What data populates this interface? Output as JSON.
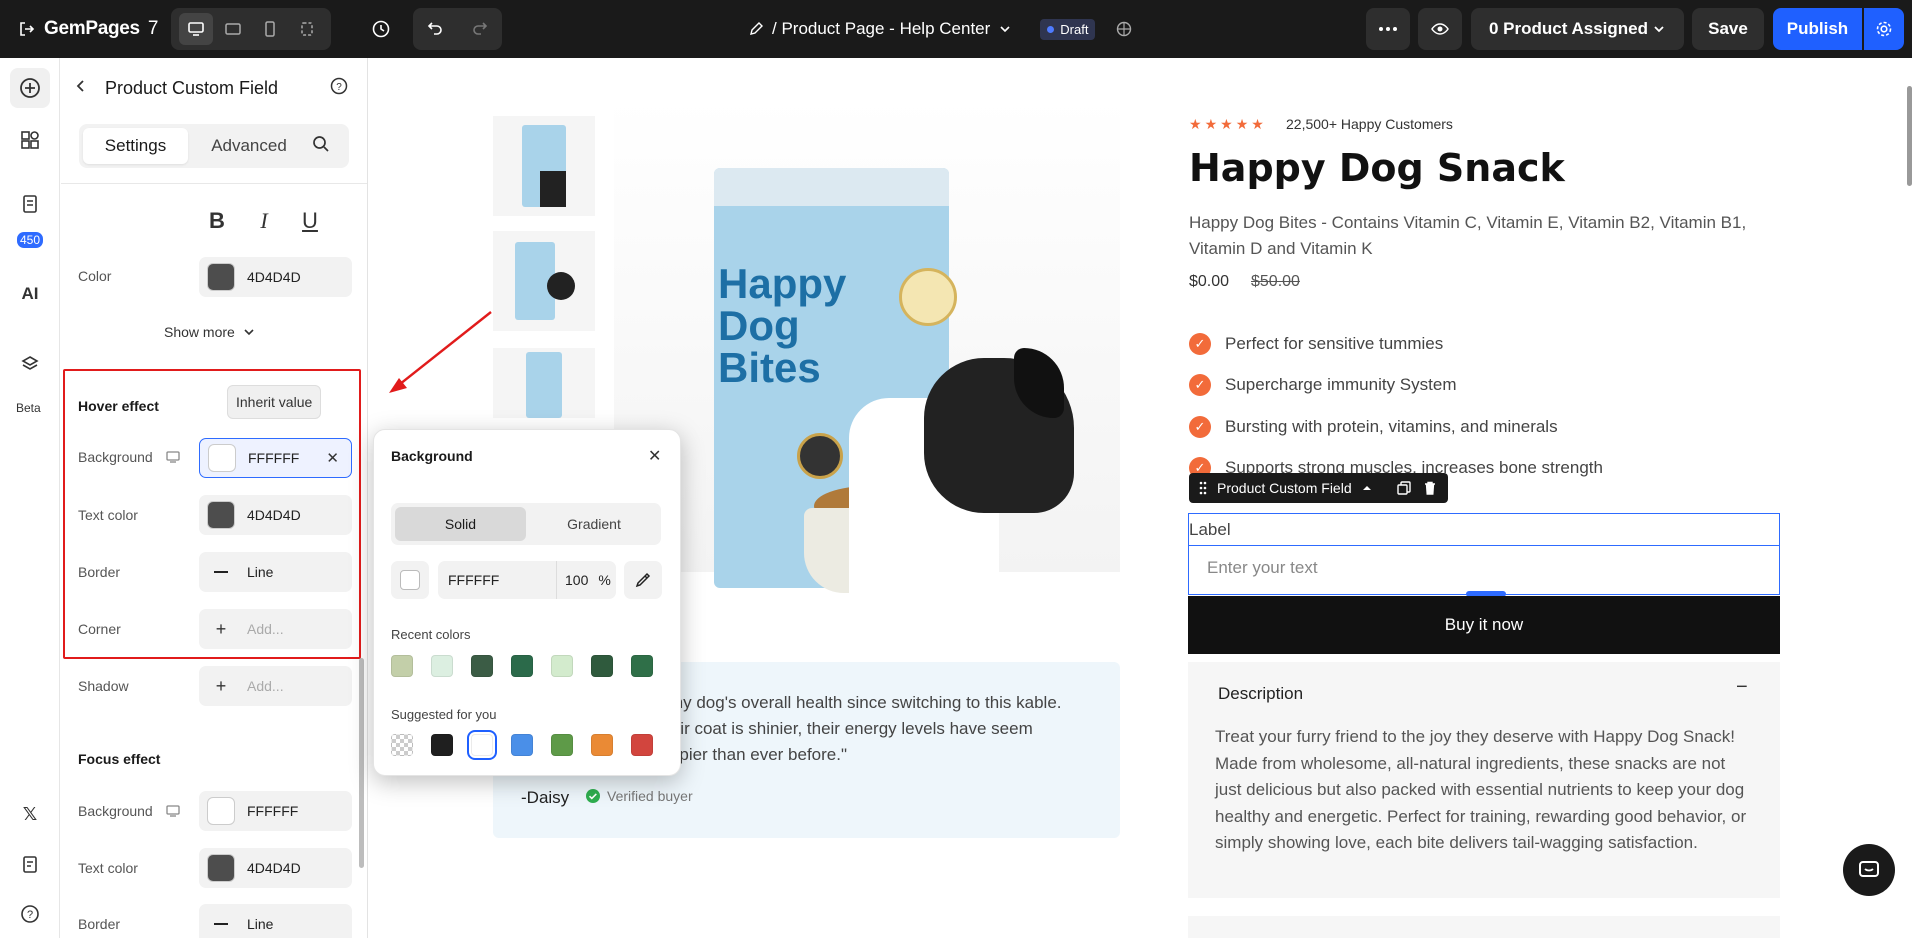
{
  "topbar": {
    "logo_text": "GemPages",
    "logo_version": "7",
    "page_title": "/ Product Page - Help Center",
    "status_badge": "Draft",
    "assigned": "0 Product Assigned",
    "save_label": "Save",
    "publish_label": "Publish"
  },
  "rail": {
    "badge_count": "450",
    "beta_label": "Beta"
  },
  "panel": {
    "title": "Product Custom Field",
    "tabs": {
      "settings": "Settings",
      "advanced": "Advanced"
    },
    "color_label": "Color",
    "color_value": "4D4D4D",
    "show_more": "Show more",
    "hover": {
      "title": "Hover effect",
      "tooltip": "Inherit value",
      "background_label": "Background",
      "background_value": "FFFFFF",
      "text_color_label": "Text color",
      "text_color_value": "4D4D4D",
      "border_label": "Border",
      "border_value": "Line",
      "corner_label": "Corner",
      "corner_value": "Add...",
      "shadow_label": "Shadow",
      "shadow_value": "Add..."
    },
    "focus": {
      "title": "Focus effect",
      "background_label": "Background",
      "background_value": "FFFFFF",
      "text_color_label": "Text color",
      "text_color_value": "4D4D4D",
      "border_label": "Border",
      "border_value": "Line"
    }
  },
  "color_popup": {
    "title": "Background",
    "tab_solid": "Solid",
    "tab_gradient": "Gradient",
    "hex": "FFFFFF",
    "opacity": "100",
    "opacity_unit": "%",
    "recent_label": "Recent colors",
    "recent_colors": [
      "#c3cfa9",
      "#dcefe1",
      "#3b5c45",
      "#2b6a4a",
      "#d3ebcd",
      "#2f5a3d",
      "#2f6f48"
    ],
    "suggested_label": "Suggested for you",
    "suggested_colors": [
      "checker",
      "#1f1f1f",
      "#ffffff",
      "#4a8fe8",
      "#5e9a48",
      "#ea8a35",
      "#d2453e"
    ]
  },
  "product": {
    "bag_text": "Happy Dog Bites",
    "rating_text": "22,500+ Happy Customers",
    "title": "Happy Dog Snack",
    "subtitle": "Happy Dog Bites - Contains Vitamin C, Vitamin E, Vitamin B2, Vitamin B1, Vitamin D and Vitamin K",
    "price": "$0.00",
    "compare_price": "$50.00",
    "features": [
      "Perfect for sensitive tummies",
      "Supercharge immunity System",
      "Bursting with protein, vitamins, and minerals",
      "Supports strong muscles, increases bone strength"
    ],
    "custom_field_tag": "Product Custom Field",
    "custom_field_label": "Label",
    "custom_field_placeholder": "Enter your text",
    "buy_label": "Buy it now",
    "description_title": "Description",
    "description_text": "Treat your furry friend to the joy they deserve with Happy Dog Snack! Made from wholesome, all-natural ingredients, these snacks are not just delicious but also packed with essential nutrients to keep your dog healthy and energetic. Perfect for training, rewarding good behavior, or simply showing love, each bite delivers tail-wagging satisfaction."
  },
  "review": {
    "text": "in my dog's overall health since switching to this kable. Their coat is shinier, their energy levels have seem happier than ever before.\"",
    "name": "-Daisy",
    "verified": "Verified buyer"
  },
  "colors": {
    "accent": "#1f60ff",
    "highlight": "#e11b1b",
    "brand_orange": "#f26b3a"
  }
}
